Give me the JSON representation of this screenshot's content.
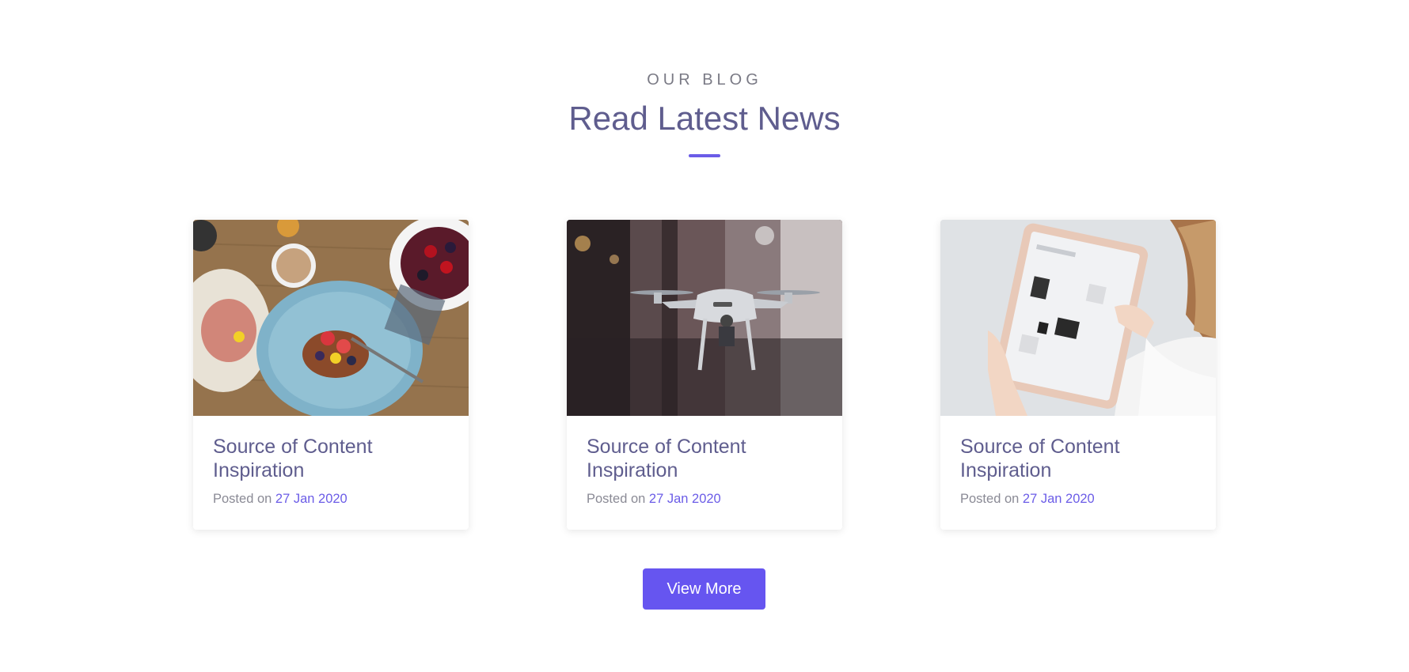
{
  "header": {
    "eyebrow": "OUR BLOG",
    "title": "Read Latest News"
  },
  "posts": [
    {
      "image": "breakfast-table-photo",
      "title": "Source of Content Inspiration",
      "posted_prefix": "Posted on",
      "date": "27 Jan 2020"
    },
    {
      "image": "drone-photo",
      "title": "Source of Content Inspiration",
      "posted_prefix": "Posted on",
      "date": "27 Jan 2020"
    },
    {
      "image": "woman-with-tablet-photo",
      "title": "Source of Content Inspiration",
      "posted_prefix": "Posted on",
      "date": "27 Jan 2020"
    }
  ],
  "actions": {
    "view_more_label": "View More"
  },
  "colors": {
    "accent": "#6655f0",
    "heading": "#5f5d8e",
    "muted": "#8a8a95"
  }
}
